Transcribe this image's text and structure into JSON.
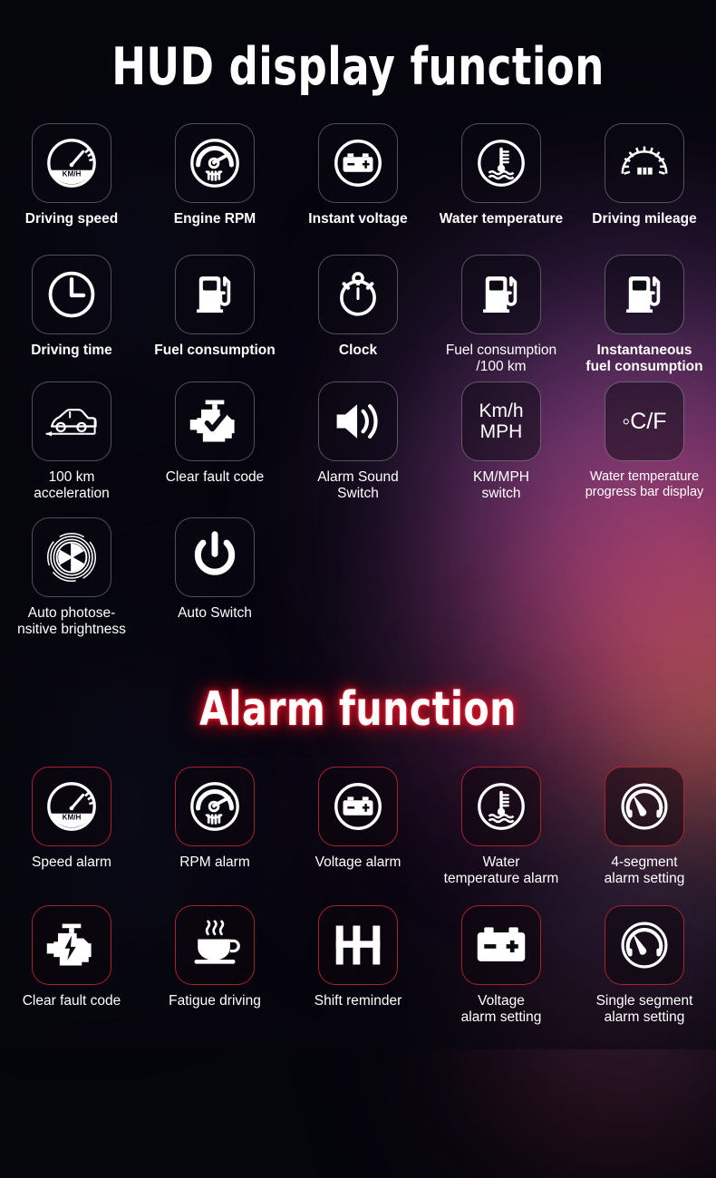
{
  "sections": [
    {
      "id": "hud",
      "title": "HUD display function",
      "title_color": "#ffffff",
      "items": [
        {
          "label": "Driving speed",
          "icon": "speedometer-kmh-icon",
          "bold": true
        },
        {
          "label": "Engine RPM",
          "icon": "tachometer-icon",
          "bold": true
        },
        {
          "label": "Instant voltage",
          "icon": "battery-circle-icon",
          "bold": true
        },
        {
          "label": "Water temperature",
          "icon": "water-temp-circle-icon",
          "bold": true
        },
        {
          "label": "Driving mileage",
          "icon": "odometer-icon",
          "bold": true
        },
        {
          "label": "Driving time",
          "icon": "clock-icon",
          "bold": true
        },
        {
          "label": "Fuel consumption",
          "icon": "fuel-pump-icon",
          "bold": true
        },
        {
          "label": "Clock",
          "icon": "stopwatch-icon",
          "bold": true
        },
        {
          "label": "Fuel consumption\n/100 km",
          "icon": "fuel-pump-icon",
          "bold": false
        },
        {
          "label": "Instantaneous\nfuel consumption",
          "icon": "fuel-pump-icon",
          "bold": true
        },
        {
          "label": "100 km\nacceleration",
          "icon": "car-acceleration-icon",
          "bold": false
        },
        {
          "label": "Clear fault code",
          "icon": "engine-check-icon",
          "bold": false
        },
        {
          "label": "Alarm Sound\nSwitch",
          "icon": "speaker-icon",
          "bold": false
        },
        {
          "label": "KM/MPH\nswitch",
          "icon": "kmh-mph-text-icon",
          "text": "Km/h\nMPH",
          "bold": false
        },
        {
          "label": "Water temperature\nprogress bar display",
          "icon": "celsius-fahrenheit-text-icon",
          "text": "◦C/F",
          "bold": false,
          "small": true
        },
        {
          "label": "Auto photose-\nnsitive brightness",
          "icon": "aperture-sensor-icon",
          "bold": false
        },
        {
          "label": "Auto Switch",
          "icon": "power-icon",
          "bold": false
        }
      ]
    },
    {
      "id": "alarm",
      "title": "Alarm function",
      "title_color": "#ffffff",
      "title_glow": "#e01024",
      "border_color": "#c42830",
      "items": [
        {
          "label": "Speed alarm",
          "icon": "speedometer-kmh-icon"
        },
        {
          "label": "RPM alarm",
          "icon": "tachometer-icon"
        },
        {
          "label": "Voltage alarm",
          "icon": "battery-circle-icon"
        },
        {
          "label": "Water\ntemperature alarm",
          "icon": "water-temp-circle-icon"
        },
        {
          "label": "4-segment\nalarm setting",
          "icon": "gauge-needle-icon"
        },
        {
          "label": "Clear fault code",
          "icon": "engine-bolt-icon"
        },
        {
          "label": "Fatigue driving",
          "icon": "coffee-cup-icon"
        },
        {
          "label": "Shift  reminder",
          "icon": "shift-h-icon"
        },
        {
          "label": "Voltage\nalarm setting",
          "icon": "battery-plain-icon"
        },
        {
          "label": "Single segment\nalarm setting",
          "icon": "gauge-needle-icon"
        }
      ]
    }
  ],
  "theme": {
    "background": "#07060f",
    "tile_border": "#ffffff4d",
    "alarm_tile_border": "#c42830",
    "icon_color": "#ffffff",
    "text_color": "#ffffff"
  }
}
